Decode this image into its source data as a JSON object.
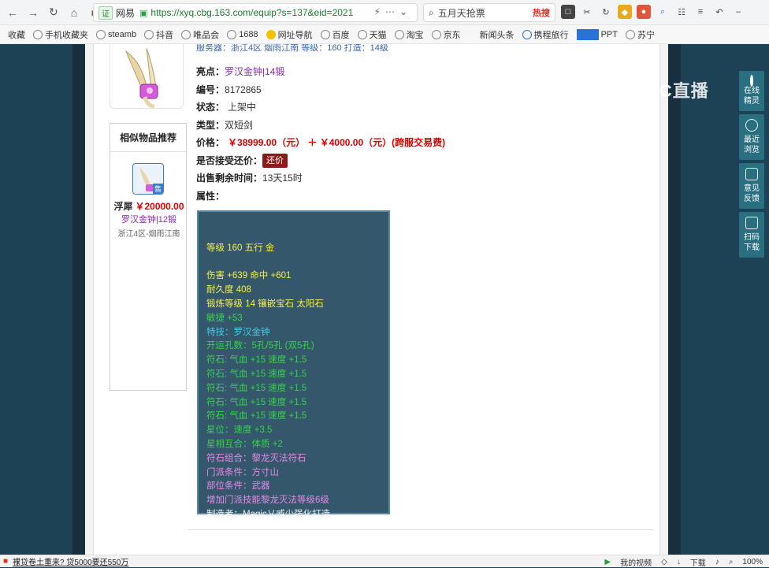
{
  "browser": {
    "url_badge": "证",
    "site_name": "网易",
    "url": "https://xyq.cbg.163.com/equip?s=137&eid=2021",
    "search_text": "五月天抢票",
    "search_hot": "热搜",
    "bookmarks": [
      "收藏",
      "手机收藏夹",
      "steamb",
      "抖音",
      "唯品会",
      "1688",
      "网址导航",
      "百度",
      "天猫",
      "淘宝",
      "京东",
      "新闻头条",
      "携程旅行",
      "PPT",
      "苏宁"
    ],
    "watermark": "CC直播"
  },
  "page": {
    "partial_top": "服务器：浙江4区   烟雨江南    等级：160    打造：14级",
    "similar": {
      "title": "相似物品推荐",
      "sold_badge": "售",
      "seller": "浮犀",
      "price": "￥20000.00",
      "subtitle": "罗汉金钟|12锻",
      "server": "浙江4区-烟雨江南"
    },
    "fields": {
      "highlight_label": "亮点：",
      "highlight_value": "罗汉金钟|14锻",
      "id_label": "编号：",
      "id_value": "8172865",
      "status_label": "状态：",
      "status_value": "上架中",
      "type_label": "类型：",
      "type_value": "双短剑",
      "price_label": "价格：",
      "price_value": "￥38999.00（元） ＋ ￥4000.00（元）(跨服交易费)",
      "offer_label": "是否接受还价：",
      "offer_button": "还价",
      "remaining_label": "出售剩余时间：",
      "remaining_value": "13天15时",
      "attr_label": "属性："
    },
    "attributes": [
      {
        "text": "",
        "color": "yellow"
      },
      {
        "text": "等级 160 五行 金",
        "color": "yellow"
      },
      {
        "text": "",
        "color": "yellow"
      },
      {
        "text": "伤害 +639 命中 +601",
        "color": "yellow"
      },
      {
        "text": "耐久度 408",
        "color": "yellow"
      },
      {
        "text": "锻炼等级 14 镶嵌宝石 太阳石",
        "color": "yellow"
      },
      {
        "text": "敏捷 +53",
        "color": "green"
      },
      {
        "text": "特技：罗汉金钟",
        "color": "cyan"
      },
      {
        "text": "开运孔数：5孔/5孔 (双5孔)",
        "color": "green"
      },
      {
        "text": "符石: 气血 +15 速度 +1.5",
        "color": "green"
      },
      {
        "text": "符石: 气血 +15 速度 +1.5",
        "color": "green"
      },
      {
        "text": "符石: 气血 +15 速度 +1.5",
        "color": "green"
      },
      {
        "text": "符石: 气血 +15 速度 +1.5",
        "color": "green"
      },
      {
        "text": "符石: 气血 +15 速度 +1.5",
        "color": "green"
      },
      {
        "text": "星位：速度 +3.5",
        "color": "green"
      },
      {
        "text": "星相互合：体质 +2",
        "color": "green"
      },
      {
        "text": "符石组合：黎龙灭法符石",
        "color": "pink"
      },
      {
        "text": "门派条件：方寸山",
        "color": "pink"
      },
      {
        "text": "部位条件：武器",
        "color": "pink"
      },
      {
        "text": "增加门派技能黎龙灭法等级6级",
        "color": "pink"
      },
      {
        "text": "制造者：Magic乂威少强化打造",
        "color": "white"
      }
    ]
  },
  "float_panel": {
    "online": "在线精灵",
    "recent": "最近浏览",
    "feedback": "意见反馈",
    "scan": "扫码下载"
  },
  "statusbar": {
    "ad_text": "裸贷卷土重来? 贷5000要还550万",
    "my_video": "我的视频",
    "download": "下载",
    "zoom": "100%"
  },
  "colors": {
    "yellow": "#f6f04a",
    "green": "#36d24a",
    "cyan": "#3bd3e8",
    "pink": "#e48ae6",
    "white": "#f2f2f2",
    "price_red": "#dd0000",
    "purple": "#8a2bb0"
  }
}
